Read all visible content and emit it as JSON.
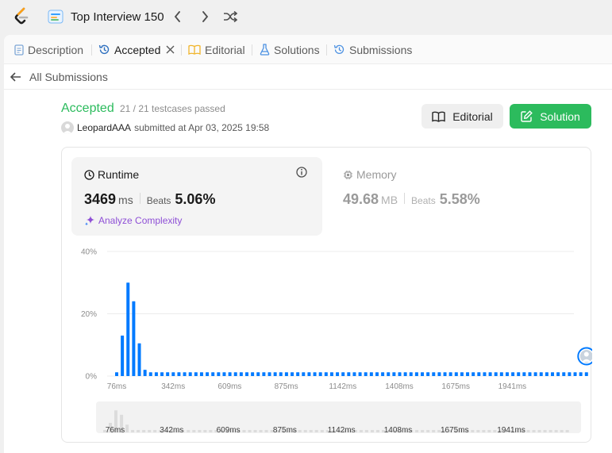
{
  "topbar": {
    "list_title": "Top Interview 150"
  },
  "tabs": [
    {
      "label": "Description"
    },
    {
      "label": "Accepted"
    },
    {
      "label": "Editorial"
    },
    {
      "label": "Solutions"
    },
    {
      "label": "Submissions"
    }
  ],
  "back_label": "All Submissions",
  "submission": {
    "status": "Accepted",
    "testcases": "21 / 21 testcases passed",
    "username": "LeopardAAA",
    "submitted_at": "submitted at Apr 03, 2025 19:58"
  },
  "buttons": {
    "editorial": "Editorial",
    "solution": "Solution"
  },
  "runtime": {
    "title": "Runtime",
    "value": "3469",
    "unit": "ms",
    "beats_label": "Beats",
    "beats": "5.06%",
    "analyze": "Analyze Complexity"
  },
  "memory": {
    "title": "Memory",
    "value": "49.68",
    "unit": "MB",
    "beats_label": "Beats",
    "beats": "5.58%"
  },
  "colors": {
    "accepted": "#2cbb5d",
    "bar": "#007aff",
    "analyze": "#8e4fd6"
  },
  "chart_data": {
    "type": "bar",
    "ylabel_ticks": [
      "0%",
      "20%",
      "40%"
    ],
    "ylim": [
      0,
      40
    ],
    "x_ticks": [
      "76ms",
      "342ms",
      "609ms",
      "875ms",
      "1142ms",
      "1408ms",
      "1675ms",
      "1941ms"
    ],
    "values": [
      1.2,
      13,
      30,
      24,
      10.5,
      2,
      1.2,
      1.2,
      1.2,
      1.2,
      1.2,
      1.2,
      1.2,
      1.2,
      1.2,
      1.2,
      1.2,
      1.2,
      1.2,
      1.2,
      1.2,
      1.2,
      1.2,
      1.2,
      1.2,
      1.2,
      1.2,
      1.2,
      1.2,
      1.2,
      1.2,
      1.2,
      1.2,
      1.2,
      1.2,
      1.2,
      1.2,
      1.2,
      1.2,
      1.2,
      1.2,
      1.2,
      1.2,
      1.2,
      1.2,
      1.2,
      1.2,
      1.2,
      1.2,
      1.2,
      1.2,
      1.2,
      1.2,
      1.2,
      1.2,
      1.2,
      1.2,
      1.2,
      1.2,
      1.2,
      1.2,
      1.2,
      1.2,
      1.2,
      1.2,
      1.2,
      1.2,
      1.2,
      1.2,
      1.2,
      1.2,
      1.2,
      1.2,
      1.2,
      1.2,
      1.2,
      1.2,
      1.2,
      1.2,
      1.2,
      1.2,
      1.2,
      1.2,
      1.2
    ],
    "user_marker_bin": 83,
    "grid": true
  }
}
